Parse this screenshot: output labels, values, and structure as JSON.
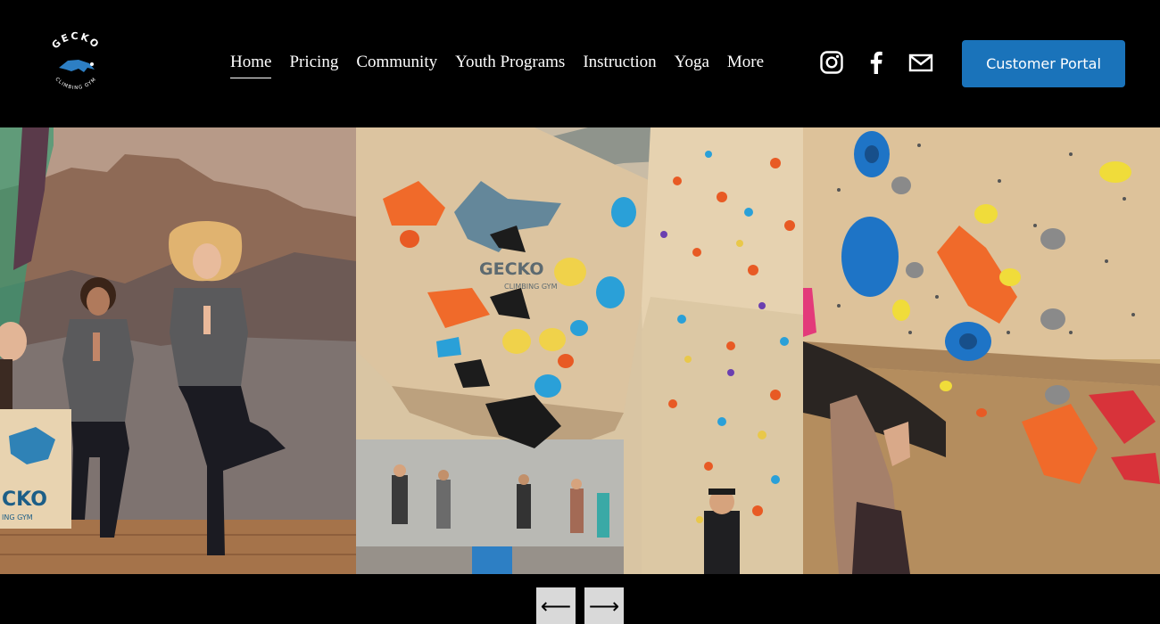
{
  "brand": {
    "logo_top": "GECKO",
    "logo_bottom": "CLIMBING GYM"
  },
  "nav": {
    "items": [
      {
        "label": "Home",
        "active": true
      },
      {
        "label": "Pricing"
      },
      {
        "label": "Community"
      },
      {
        "label": "Youth Programs"
      },
      {
        "label": "Instruction"
      },
      {
        "label": "Yoga"
      },
      {
        "label": "More"
      }
    ]
  },
  "socials": [
    {
      "icon": "instagram-icon"
    },
    {
      "icon": "facebook-icon"
    },
    {
      "icon": "email-icon"
    }
  ],
  "portal_button": {
    "label": "Customer Portal"
  },
  "gallery": {
    "prev_label": "⟵",
    "next_label": "⟶",
    "slides": [
      {
        "subject": "yoga instructors"
      },
      {
        "subject": "gym climbing wall"
      },
      {
        "subject": "bouldering wall close-up"
      }
    ],
    "wall_logo_text": "GECKO",
    "wall_logo_sub": "CLIMBING GYM"
  },
  "colors": {
    "accent": "#1a73ba",
    "background": "#000000",
    "control_bg": "#d9d9d9"
  }
}
